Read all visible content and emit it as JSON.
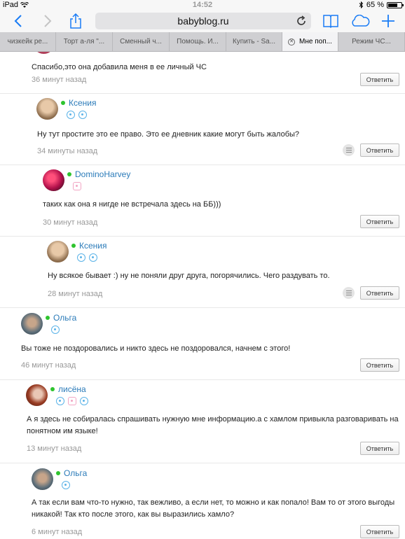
{
  "status_bar": {
    "device": "iPad",
    "time": "14:52",
    "battery": "65 %"
  },
  "browser": {
    "url": "babyblog.ru",
    "tabs": [
      {
        "label": "чизкейк ре...",
        "active": false
      },
      {
        "label": "Торт а-ля \"...",
        "active": false
      },
      {
        "label": "Сменный ч...",
        "active": false
      },
      {
        "label": "Помощь. И...",
        "active": false
      },
      {
        "label": "Купить - Sa...",
        "active": false
      },
      {
        "label": "Мне поп...",
        "active": true
      },
      {
        "label": "Режим ЧС...",
        "active": false
      }
    ]
  },
  "reply_label": "Ответить",
  "comments": [
    {
      "author": "",
      "text": "Спасибо,это она добавила меня в ее личный ЧС",
      "time": "36 минут назад"
    },
    {
      "author": "Ксения",
      "text": "Ну тут простите это ее право. Это ее дневник какие могут быть жалобы?",
      "time": "34 минуты назад"
    },
    {
      "author": "DominoHarvey",
      "text": "таких как она я нигде не встречала здесь на ББ)))",
      "time": "30 минут назад"
    },
    {
      "author": "Ксения",
      "text": "Ну всякое бывает :) ну не поняли друг друга, погорячились. Чего раздувать то.",
      "time": "28 минут назад"
    },
    {
      "author": "Ольга",
      "text": "Вы тоже не поздоровались и никто здесь не поздоровался, начнем с этого!",
      "time": "46 минут назад"
    },
    {
      "author": "лисёна",
      "text_lines": [
        "А я здесь не собиралась спрашивать нужную мне информацию.а с хамлом привыкла разговаривать на",
        "понятном им языке!"
      ],
      "time": "13 минут назад"
    },
    {
      "author": "Ольга",
      "text_lines": [
        "А так если вам что-то нужно, так вежливо, а если нет, то можно и как попало! Вам то от этого выгоды",
        "никакой! Так кто после этого, как вы выразились хамло?"
      ],
      "time": "6 минут назад"
    }
  ]
}
